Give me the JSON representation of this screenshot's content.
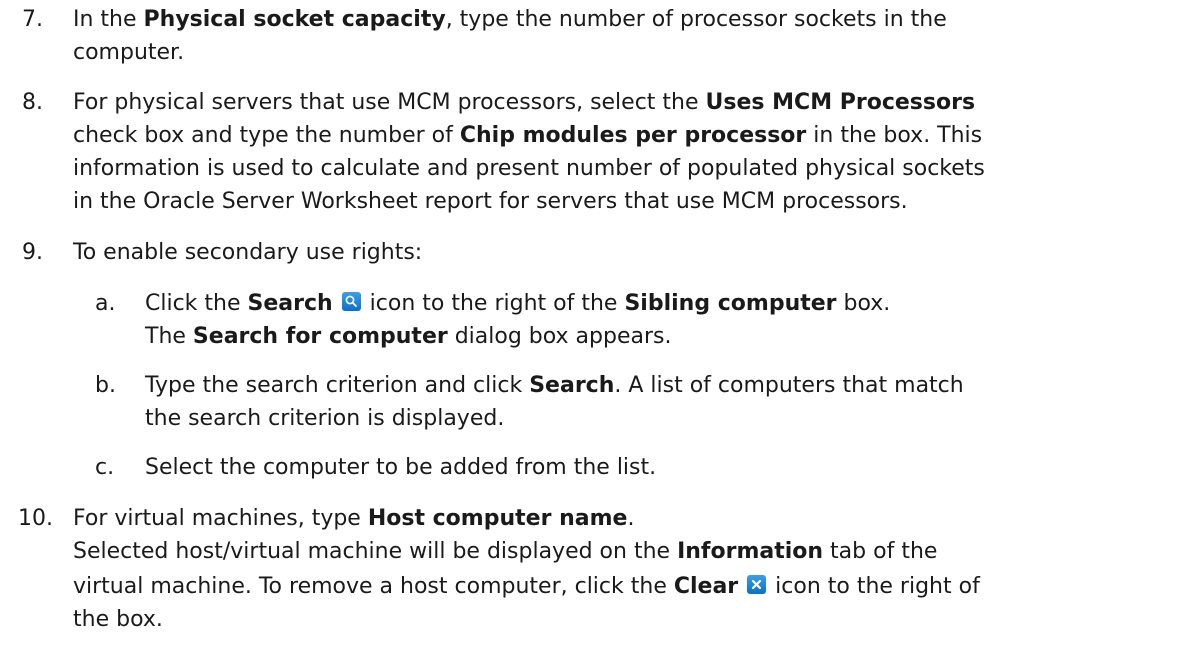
{
  "step7": {
    "number": "7.",
    "line1_pre": "In the ",
    "line1_bold": "Physical socket capacity",
    "line1_post": ", type the number of processor sockets in the",
    "line2": "computer."
  },
  "step8": {
    "number": "8.",
    "line1_pre": "For physical servers that use MCM processors, select the ",
    "line1_bold": "Uses MCM Processors",
    "line2_pre": "check box and type the number of ",
    "line2_bold": "Chip modules per processor",
    "line2_post": " in the box. This",
    "line3": "information is used to calculate and present number of populated physical sockets",
    "line4": "in the Oracle Server Worksheet report for servers that use MCM processors."
  },
  "step9": {
    "number": "9.",
    "text": "To enable secondary use rights:",
    "sub_a": {
      "letter": "a.",
      "line1_pre": "Click the ",
      "line1_bold1": "Search",
      "line1_mid": " icon to the right of the ",
      "line1_bold2": "Sibling computer",
      "line1_post": " box.",
      "line2_pre": "The ",
      "line2_bold": "Search for computer",
      "line2_post": " dialog box appears.",
      "icon": "search-icon"
    },
    "sub_b": {
      "letter": "b.",
      "line1_pre": "Type the search criterion and click ",
      "line1_bold": "Search",
      "line1_post": ". A list of computers that match",
      "line2": "the search criterion is displayed."
    },
    "sub_c": {
      "letter": "c.",
      "text": "Select the computer to be added from the list."
    }
  },
  "step10": {
    "number": "10.",
    "line1_pre": "For virtual machines, type ",
    "line1_bold": "Host computer name",
    "line1_post": ".",
    "line2_pre": "Selected host/virtual machine will be displayed on the ",
    "line2_bold": "Information",
    "line2_post": " tab of the",
    "line3_pre": "virtual machine. To remove a host computer, click the ",
    "line3_bold": "Clear",
    "line3_post": " icon to the right of",
    "line4": "the box.",
    "icon": "clear-icon"
  },
  "colors": {
    "text": "#1a1a1a",
    "icon_blue": "#1f80d4"
  }
}
